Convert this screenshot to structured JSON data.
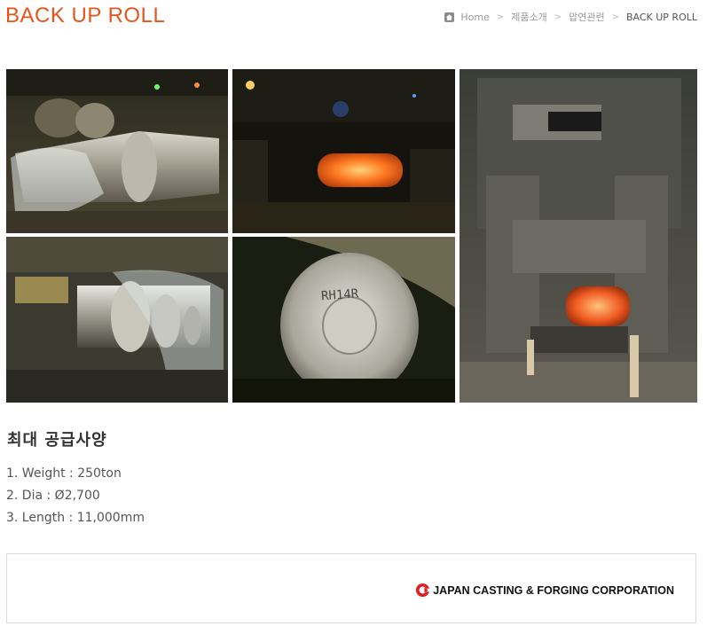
{
  "header": {
    "title": "BACK UP ROLL",
    "breadcrumb": [
      {
        "label": "Home"
      },
      {
        "label": "제품소개"
      },
      {
        "label": "압연관련"
      },
      {
        "label": "BACK UP ROLL"
      }
    ]
  },
  "gallery": {
    "images": [
      {
        "name": "roll-in-workshop-photo"
      },
      {
        "name": "glowing-ingot-photo"
      },
      {
        "name": "forging-press-photo"
      },
      {
        "name": "machined-roll-photo"
      },
      {
        "name": "roll-end-marking-photo",
        "marking": "RH14R"
      }
    ]
  },
  "specs": {
    "title": "최대 공급사양",
    "items": [
      "1. Weight : 250ton",
      "2. Dia : Ø2,700",
      "3. Length : 11,000mm"
    ]
  },
  "maker": {
    "name": "JAPAN CASTING & FORGING CORPORATION",
    "logo_icon": "circle-arrow-logo",
    "logo_color": "#e01e25"
  },
  "colors": {
    "accent": "#e8551c"
  }
}
